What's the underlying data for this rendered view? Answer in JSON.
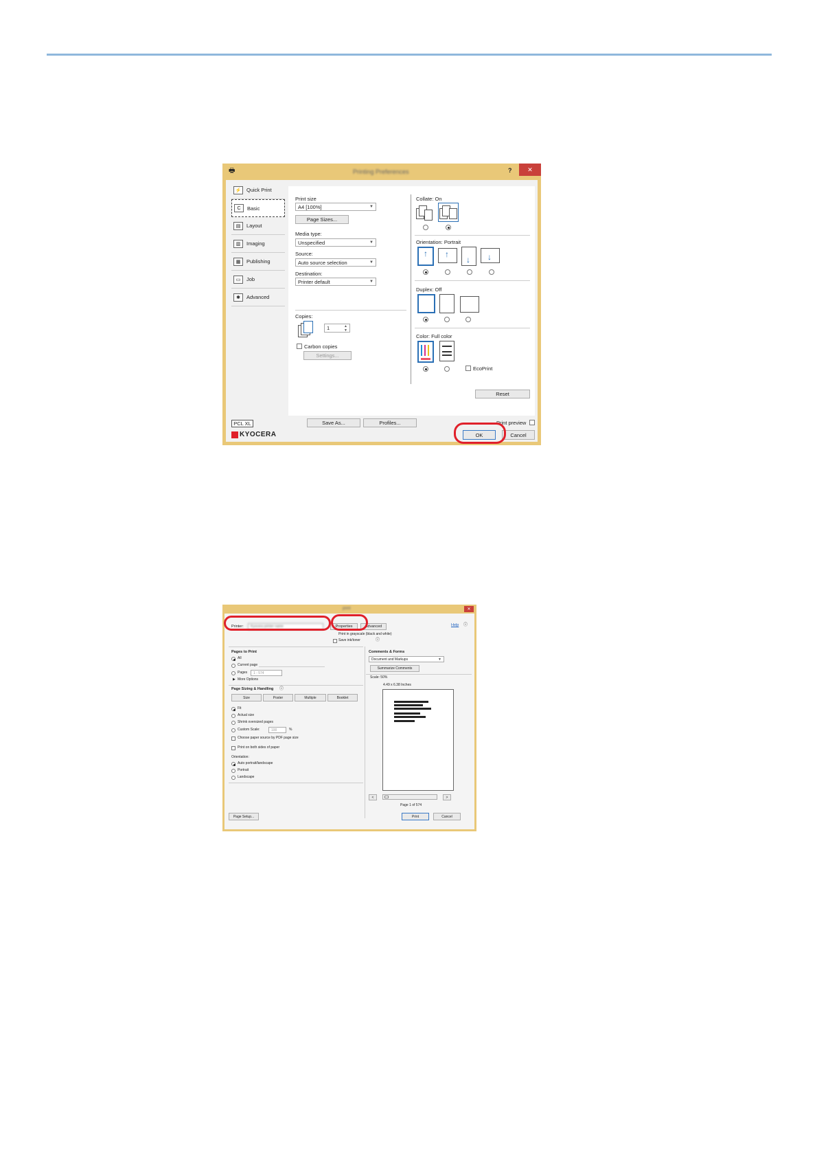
{
  "dialog1": {
    "title": "Printing Preferences",
    "help": "?",
    "close": "✕",
    "nav": [
      "Quick Print",
      "Basic",
      "Layout",
      "Imaging",
      "Publishing",
      "Job",
      "Advanced"
    ],
    "print_size_label": "Print size",
    "print_size_value": "A4 [100%]",
    "page_sizes_button": "Page Sizes...",
    "media_type_label": "Media type:",
    "media_type_value": "Unspecified",
    "source_label": "Source:",
    "source_value": "Auto source selection",
    "destination_label": "Destination:",
    "destination_value": "Printer default",
    "copies_label": "Copies:",
    "copies_value": "1",
    "carbon_copies_label": "Carbon copies",
    "settings_button": "Settings...",
    "collate_label": "Collate:  On",
    "orientation_label": "Orientation:  Portrait",
    "duplex_label": "Duplex:  Off",
    "color_label": "Color:  Full color",
    "ecoprint_label": "EcoPrint",
    "reset_button": "Reset",
    "pcl_badge": "PCL XL",
    "save_as_button": "Save As...",
    "profiles_button": "Profiles...",
    "print_preview_label": "Print preview",
    "ok_button": "OK",
    "cancel_button": "Cancel",
    "brand": "KYOCERA",
    "accent": "#e9c878",
    "highlight": "#e0202a"
  },
  "dialog2": {
    "title": "print",
    "printer_label": "Printer:",
    "printer_value": "Kyocera printer name",
    "properties_button": "Properties",
    "advanced_button": "Advanced",
    "help_link": "Help",
    "grayscale_label": "Print in grayscale (black and white)",
    "save_ink_label": "Save ink/toner",
    "pages_to_print": "Pages to Print",
    "all_label": "All",
    "current_page_label": "Current page",
    "pages_label": "Pages",
    "pages_value": "1 - 574",
    "more_options": "More Options",
    "page_sizing": "Page Sizing & Handling",
    "size_buttons": [
      "Size",
      "Poster",
      "Multiple",
      "Booklet"
    ],
    "fit_label": "Fit",
    "actual_size_label": "Actual size",
    "shrink_label": "Shrink oversized pages",
    "custom_scale_label": "Custom Scale:",
    "custom_scale_value": "100",
    "percent": "%",
    "choose_paper_label": "Choose paper source by PDF page size",
    "both_sides_label": "Print on both sides of paper",
    "orientation_title": "Orientation:",
    "auto_portrait_label": "Auto portrait/landscape",
    "portrait_label": "Portrait",
    "landscape_label": "Landscape",
    "comments_forms": "Comments & Forms",
    "comments_value": "Document and Markups",
    "summarize_button": "Summarize Comments",
    "scale_label": "Scale:  50%",
    "dims_label": "4.49 x 6.38 Inches",
    "page_counter": "Page 1 of 574",
    "prev": "<",
    "next": ">",
    "page_setup_button": "Page Setup...",
    "print_button": "Print",
    "cancel_button": "Cancel",
    "close": "✕"
  }
}
